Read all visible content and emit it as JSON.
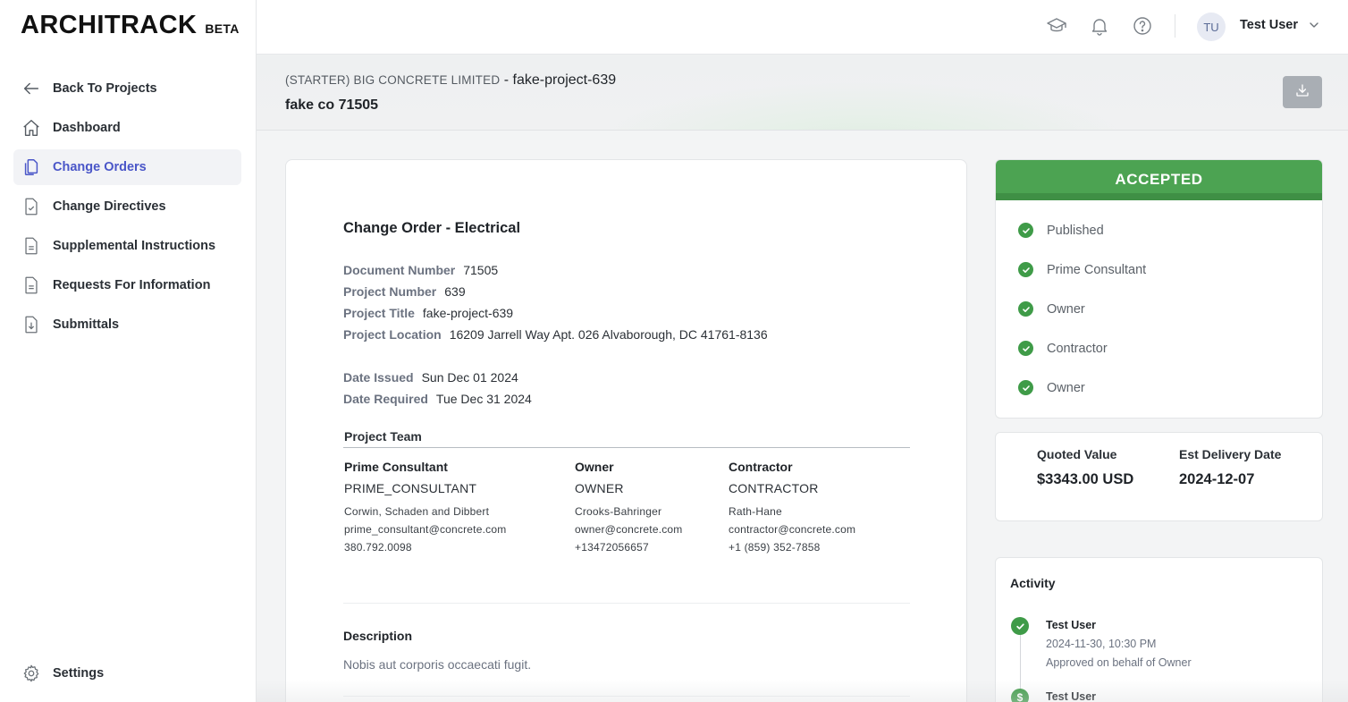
{
  "app": {
    "logo": "ARCHITRACK",
    "logo_badge": "BETA"
  },
  "sidebar": {
    "items": [
      {
        "label": "Back To Projects",
        "icon": "arrow-left-icon"
      },
      {
        "label": "Dashboard",
        "icon": "home-icon"
      },
      {
        "label": "Change Orders",
        "icon": "documents-icon",
        "active": true
      },
      {
        "label": "Change Directives",
        "icon": "document-check-icon"
      },
      {
        "label": "Supplemental Instructions",
        "icon": "document-text-icon"
      },
      {
        "label": "Requests For Information",
        "icon": "document-text-icon"
      },
      {
        "label": "Submittals",
        "icon": "document-download-icon"
      }
    ],
    "settings_label": "Settings"
  },
  "topbar": {
    "user_initials": "TU",
    "user_name": "Test User"
  },
  "header": {
    "company": "(STARTER) BIG CONCRETE LIMITED",
    "separator": " - ",
    "project": "fake-project-639",
    "subtitle": "fake co 71505"
  },
  "document": {
    "title": "Change Order - Electrical",
    "fields": {
      "document_number": {
        "label": "Document Number",
        "value": "71505"
      },
      "project_number": {
        "label": "Project Number",
        "value": "639"
      },
      "project_title": {
        "label": "Project Title",
        "value": "fake-project-639"
      },
      "project_location": {
        "label": "Project Location",
        "value": "16209 Jarrell Way Apt. 026 Alvaborough, DC 41761-8136"
      },
      "date_issued": {
        "label": "Date Issued",
        "value": "Sun Dec 01 2024"
      },
      "date_required": {
        "label": "Date Required",
        "value": "Tue Dec 31 2024"
      }
    },
    "team_title": "Project Team",
    "team": [
      {
        "role": "Prime Consultant",
        "code": "PRIME_CONSULTANT",
        "company": "Corwin, Schaden and Dibbert",
        "email": "prime_consultant@concrete.com",
        "phone": "380.792.0098"
      },
      {
        "role": "Owner",
        "code": "OWNER",
        "company": "Crooks-Bahringer",
        "email": "owner@concrete.com",
        "phone": "+13472056657"
      },
      {
        "role": "Contractor",
        "code": "CONTRACTOR",
        "company": "Rath-Hane",
        "email": "contractor@concrete.com",
        "phone": "+1 (859) 352-7858"
      }
    ],
    "description_title": "Description",
    "description": "Nobis aut corporis occaecati fugit."
  },
  "status": {
    "label": "ACCEPTED",
    "color": "#4ca352",
    "steps": [
      "Published",
      "Prime Consultant",
      "Owner",
      "Contractor",
      "Owner"
    ]
  },
  "quote": {
    "quoted_label": "Quoted Value",
    "quoted_value": "$3343.00 USD",
    "delivery_label": "Est Delivery Date",
    "delivery_value": "2024-12-07"
  },
  "activity": {
    "title": "Activity",
    "items": [
      {
        "user": "Test User",
        "time": "2024-11-30, 10:30 PM",
        "message": "Approved on behalf of Owner",
        "icon": "check-circle-icon"
      },
      {
        "user": "Test User",
        "icon": "dollar-circle-icon"
      }
    ]
  }
}
